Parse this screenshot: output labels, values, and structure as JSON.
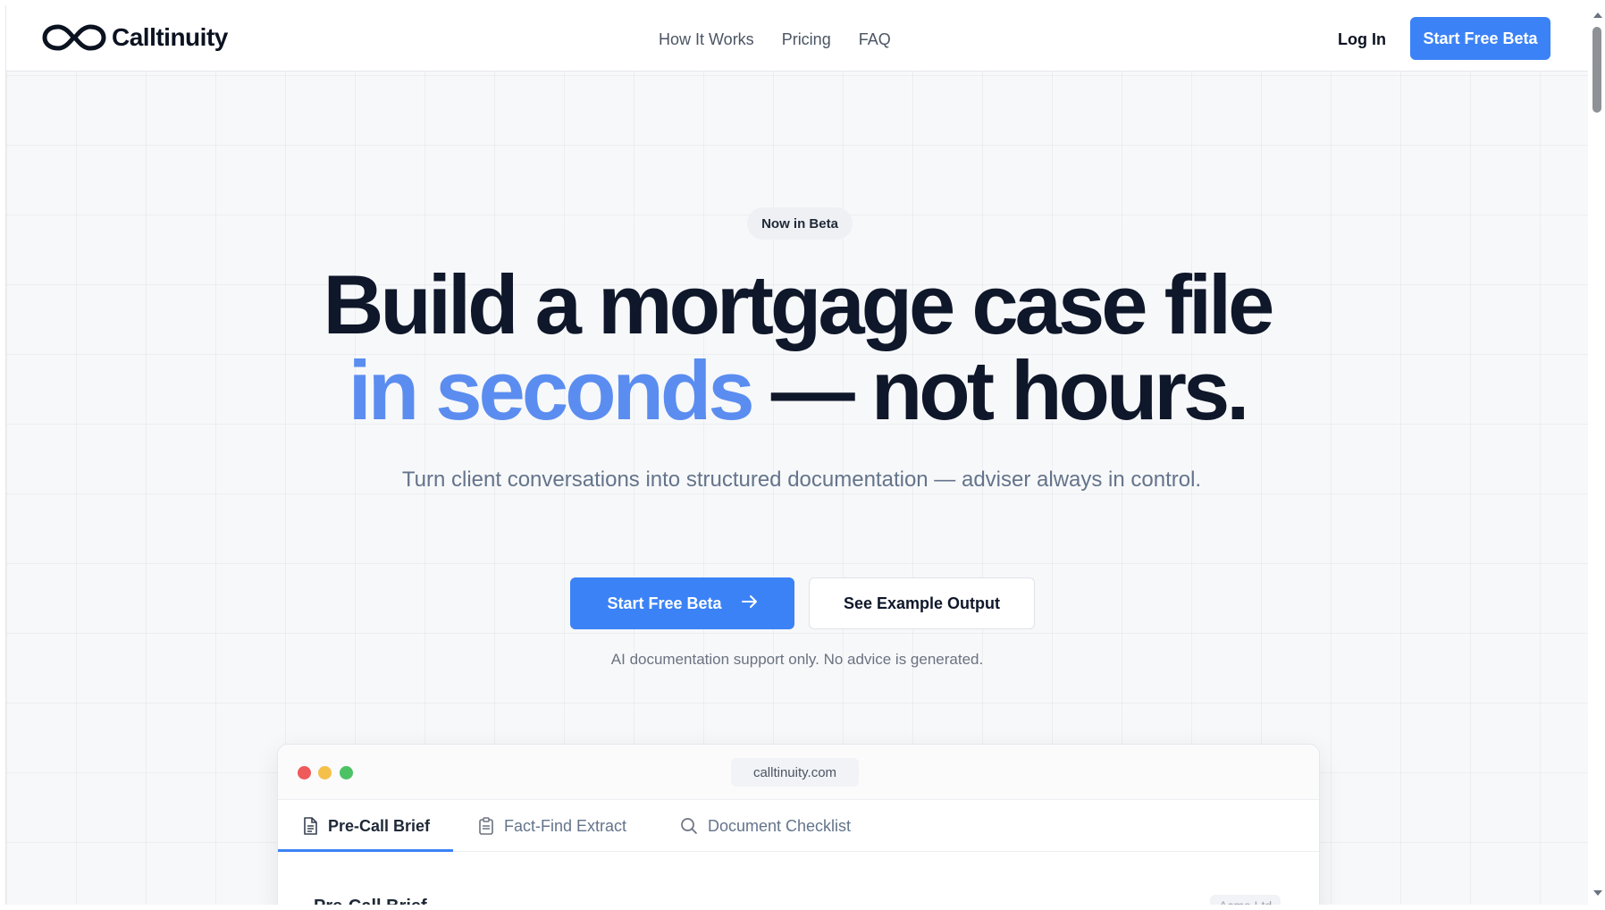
{
  "brand": {
    "name": "Calltinuity",
    "logo_icon": "infinity-icon"
  },
  "nav": {
    "links": [
      "How It Works",
      "Pricing",
      "FAQ"
    ],
    "login": "Log In",
    "cta": "Start Free Beta"
  },
  "hero": {
    "badge": "Now in Beta",
    "headline_line1": "Build a mortgage case file",
    "headline_accent": "in seconds",
    "headline_rest": " — not hours.",
    "subtitle": "Turn client conversations into structured documentation — adviser always in control.",
    "primary_cta": "Start Free Beta",
    "primary_cta_icon": "arrow-right-icon",
    "secondary_cta": "See Example Output",
    "disclaimer": "AI documentation support only. No advice is generated."
  },
  "preview": {
    "url": "calltinuity.com",
    "tabs": [
      {
        "label": "Pre-Call Brief",
        "icon": "document-icon",
        "active": true
      },
      {
        "label": "Fact-Find Extract",
        "icon": "clipboard-icon",
        "active": false
      },
      {
        "label": "Document Checklist",
        "icon": "search-icon",
        "active": false
      }
    ],
    "panel_title": "Pre-Call Brief",
    "panel_tag": "Acme Ltd"
  },
  "colors": {
    "accent": "#3b82f6",
    "headline_accent": "#5b8df0",
    "text_dark": "#0f172a",
    "text_muted": "#64748b"
  }
}
